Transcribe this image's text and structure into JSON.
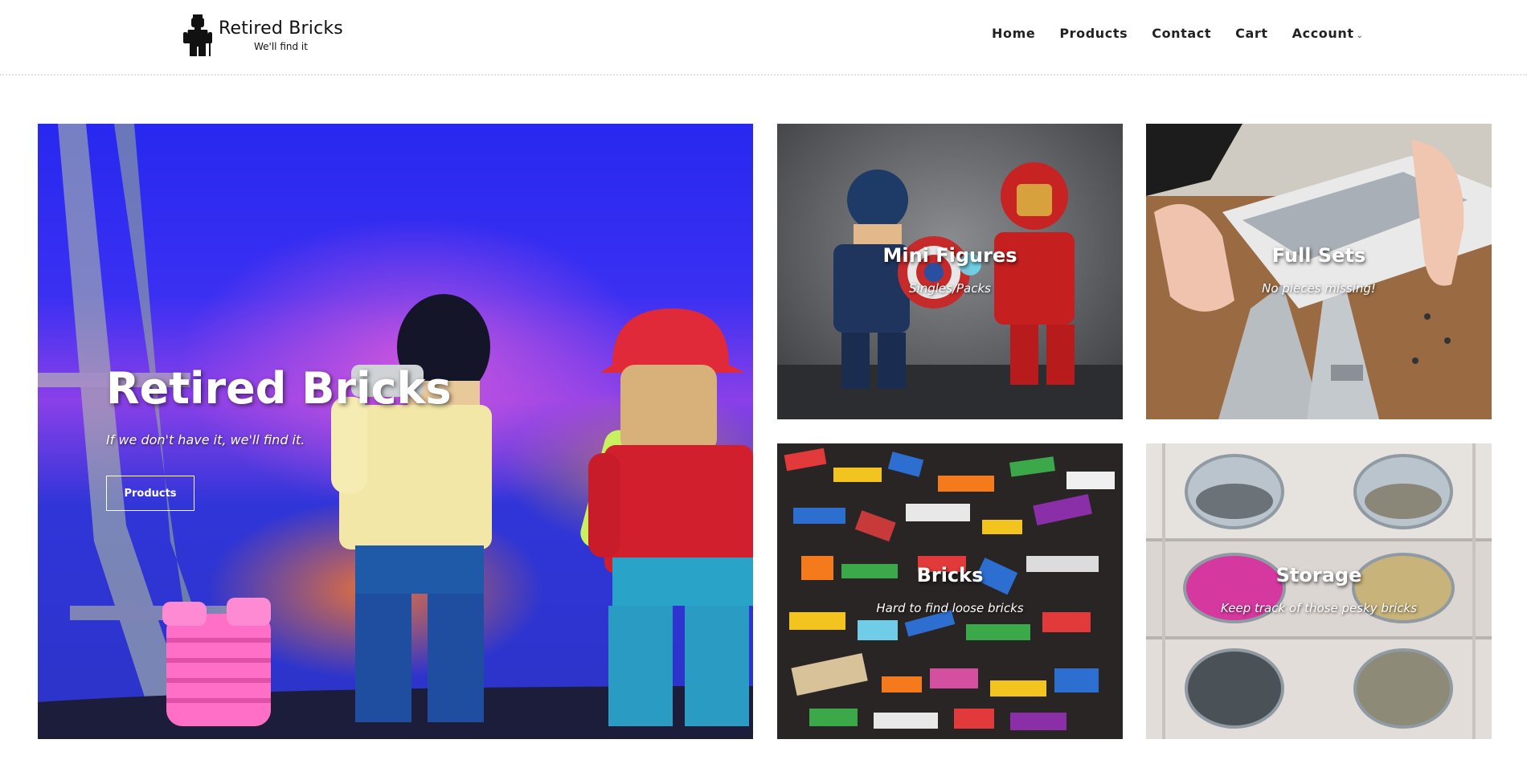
{
  "header": {
    "brand_name": "Retired Bricks",
    "tagline": "We'll find it",
    "logo_icon": "minifigure-icon",
    "nav": [
      {
        "label": "Home"
      },
      {
        "label": "Products"
      },
      {
        "label": "Contact"
      },
      {
        "label": "Cart"
      },
      {
        "label": "Account",
        "has_dropdown": true
      }
    ]
  },
  "hero": {
    "title": "Retired Bricks",
    "subtitle": "If we don't have it, we'll find it.",
    "button_label": "Products"
  },
  "categories": [
    {
      "title": "Mini Figures",
      "subtitle": "Singles/Packs"
    },
    {
      "title": "Full Sets",
      "subtitle": "No pieces missing!"
    },
    {
      "title": "Bricks",
      "subtitle": "Hard to find loose bricks"
    },
    {
      "title": "Storage",
      "subtitle": "Keep track of those pesky bricks"
    }
  ],
  "colors": {
    "text_dark": "#222222",
    "hero_blue": "#2828f0",
    "overlay_text": "#ffffff"
  }
}
